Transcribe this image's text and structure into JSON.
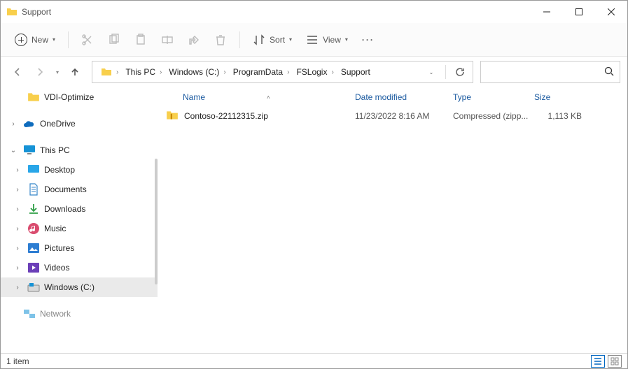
{
  "window": {
    "title": "Support"
  },
  "toolbar": {
    "new_label": "New",
    "sort_label": "Sort",
    "view_label": "View"
  },
  "breadcrumb": {
    "segments": [
      "This PC",
      "Windows (C:)",
      "ProgramData",
      "FSLogix",
      "Support"
    ]
  },
  "search": {
    "placeholder": ""
  },
  "tree": {
    "top": {
      "label": "VDI-Optimize"
    },
    "onedrive": {
      "label": "OneDrive"
    },
    "thispc": {
      "label": "This PC",
      "children": [
        {
          "label": "Desktop"
        },
        {
          "label": "Documents"
        },
        {
          "label": "Downloads"
        },
        {
          "label": "Music"
        },
        {
          "label": "Pictures"
        },
        {
          "label": "Videos"
        },
        {
          "label": "Windows (C:)",
          "selected": true
        }
      ]
    },
    "network": {
      "label": "Network"
    }
  },
  "columns": {
    "name": "Name",
    "date": "Date modified",
    "type": "Type",
    "size": "Size"
  },
  "files": [
    {
      "name": "Contoso-22112315.zip",
      "date": "11/23/2022 8:16 AM",
      "type": "Compressed (zipp...",
      "size": "1,113 KB"
    }
  ],
  "status": {
    "count_label": "1 item"
  }
}
